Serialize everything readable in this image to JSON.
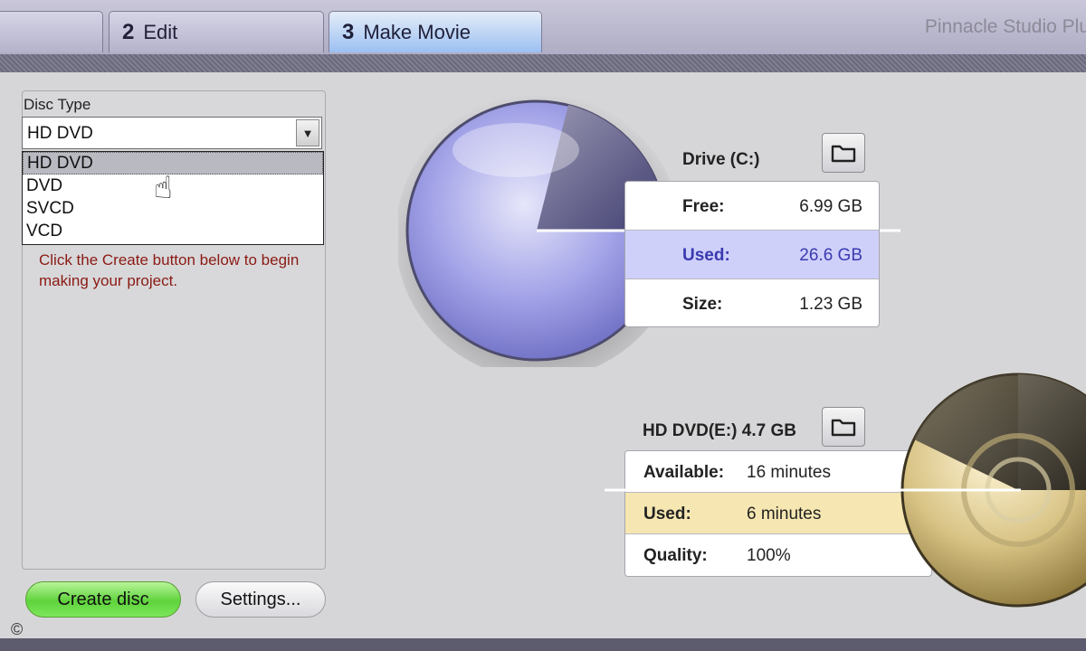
{
  "tabs": [
    {
      "num": "",
      "label": ""
    },
    {
      "num": "2",
      "label": "Edit"
    },
    {
      "num": "3",
      "label": "Make Movie"
    }
  ],
  "app_title": "Pinnacle Studio Plu",
  "disc_type": {
    "label": "Disc Type",
    "selected": "HD DVD",
    "options": [
      "HD DVD",
      "DVD",
      "SVCD",
      "VCD"
    ]
  },
  "hint": "Click the Create button below to begin making your project.",
  "buttons": {
    "create": "Create disc",
    "settings": "Settings..."
  },
  "drive": {
    "title": "Drive (C:)",
    "rows": [
      {
        "label": "Free:",
        "value": "6.99 GB"
      },
      {
        "label": "Used:",
        "value": "26.6 GB"
      },
      {
        "label": "Size:",
        "value": "1.23 GB"
      }
    ]
  },
  "disc": {
    "title": "HD DVD(E:) 4.7 GB",
    "rows": [
      {
        "label": "Available:",
        "value": "16 minutes"
      },
      {
        "label": "Used:",
        "value": "6 minutes"
      },
      {
        "label": "Quality:",
        "value": "100%"
      }
    ]
  },
  "copyright": "©",
  "colors": {
    "create_green": "#5fd33c",
    "used_drive_bg": "#cfd0fa",
    "used_drive_text": "#3a3ab0",
    "used_disc_bg": "#f6e7b2",
    "hint_text": "#8b1a14"
  }
}
